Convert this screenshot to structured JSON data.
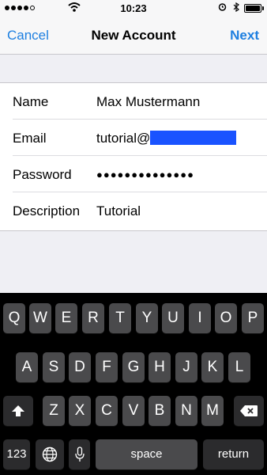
{
  "status_bar": {
    "time": "10:23"
  },
  "nav": {
    "cancel": "Cancel",
    "title": "New Account",
    "next": "Next"
  },
  "form": {
    "rows": [
      {
        "label": "Name",
        "value": "Max Mustermann"
      },
      {
        "label": "Email",
        "value": "tutorial@"
      },
      {
        "label": "Password",
        "value": "●●●●●●●●●●●●●●"
      },
      {
        "label": "Description",
        "value": "Tutorial"
      }
    ]
  },
  "keyboard": {
    "row1": [
      "Q",
      "W",
      "E",
      "R",
      "T",
      "Y",
      "U",
      "I",
      "O",
      "P"
    ],
    "row2": [
      "A",
      "S",
      "D",
      "F",
      "G",
      "H",
      "J",
      "K",
      "L"
    ],
    "row3": [
      "Z",
      "X",
      "C",
      "V",
      "B",
      "N",
      "M"
    ],
    "numbers_key": "123",
    "space_key": "space",
    "return_key": "return"
  },
  "colors": {
    "accent": "#1e7fe0",
    "redaction": "#1a53ff"
  },
  "icons": [
    "wifi-icon",
    "alarm-icon",
    "bluetooth-icon",
    "battery-icon",
    "shift-icon",
    "globe-icon",
    "microphone-icon",
    "delete-icon"
  ]
}
